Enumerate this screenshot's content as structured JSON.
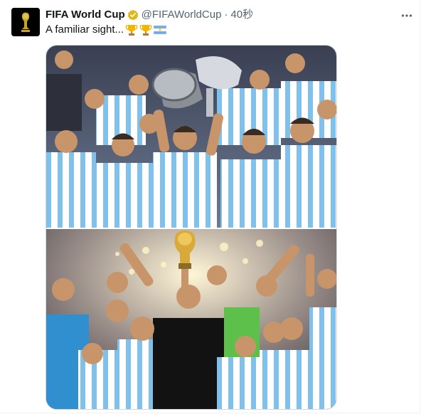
{
  "tweet": {
    "display_name": "FIFA World Cup",
    "handle": "@FIFAWorldCup",
    "separator": "·",
    "timestamp": "40秒",
    "text": "A familiar sight...",
    "emojis": [
      "trophy-emoji",
      "trophy-emoji",
      "argentina-flag-emoji"
    ],
    "verified_badge_color": "#e2b719"
  },
  "media": {
    "photos": [
      {
        "description_icon": "team-celebration-photo",
        "accent": "#6fb6e8"
      },
      {
        "description_icon": "world-cup-trophy-photo",
        "accent": "#6fb6e8"
      }
    ]
  },
  "colors": {
    "text": "#0f1419",
    "secondary": "#536471",
    "border": "#cfd9de"
  }
}
